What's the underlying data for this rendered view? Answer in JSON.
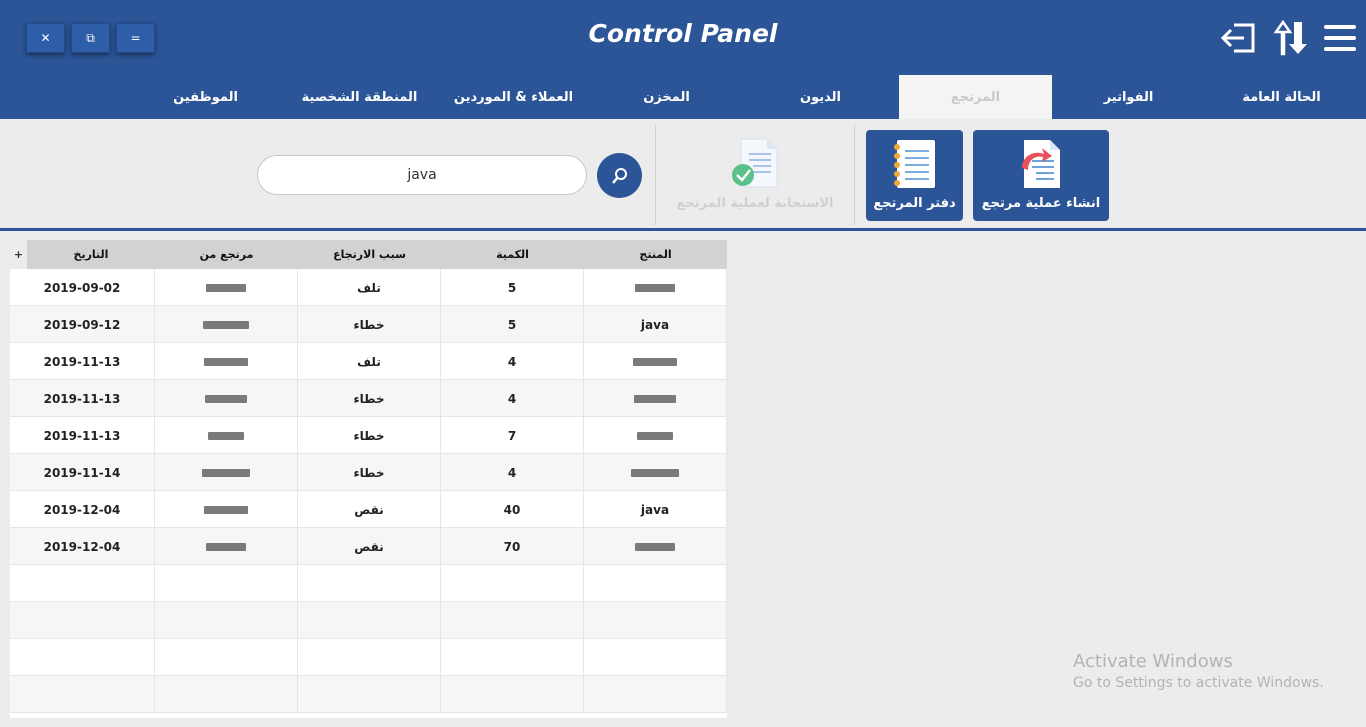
{
  "window": {
    "title": "Control Panel",
    "buttons": [
      {
        "id": "close",
        "glyph": "✕"
      },
      {
        "id": "restore",
        "glyph": "⧉"
      },
      {
        "id": "minimize",
        "glyph": "="
      }
    ]
  },
  "header_icons": [
    "logout-icon",
    "sort-icon",
    "menu-icon"
  ],
  "tabs": [
    {
      "label": "الحالة العامة",
      "active": false
    },
    {
      "label": "الفواتير",
      "active": false
    },
    {
      "label": "المرتجع",
      "active": true
    },
    {
      "label": "الديون",
      "active": false
    },
    {
      "label": "المخزن",
      "active": false
    },
    {
      "label": "العملاء  &  الموردين",
      "active": false
    },
    {
      "label": "المنطقة الشخصية",
      "active": false
    },
    {
      "label": "الموظفين",
      "active": false
    }
  ],
  "toolbar": {
    "create_return_label": "انشاء عملية مرتجع",
    "returns_ledger_label": "دفتر المرتجع",
    "respond_return_label": "الاستجابة لعملية المرتجع",
    "search_value": "java"
  },
  "table": {
    "corner_glyph": "+",
    "columns": [
      "المنتج",
      "الكمية",
      "سبب الارتجاع",
      "مرتجع من",
      "التاريخ"
    ],
    "rows": [
      {
        "product": "■■■■",
        "qty": "5",
        "reason": "تلف",
        "from": "■■■■",
        "date": "2019-09-02"
      },
      {
        "product": "java",
        "qty": "5",
        "reason": "خطاء",
        "from": "■■■■",
        "date": "2019-09-12"
      },
      {
        "product": "■■■■",
        "qty": "4",
        "reason": "تلف",
        "from": "■■■■",
        "date": "2019-11-13"
      },
      {
        "product": "■■■■",
        "qty": "4",
        "reason": "خطاء",
        "from": "■■■■",
        "date": "2019-11-13"
      },
      {
        "product": "■■■■",
        "qty": "7",
        "reason": "خطاء",
        "from": "■■■■",
        "date": "2019-11-13"
      },
      {
        "product": "■■■■",
        "qty": "4",
        "reason": "خطاء",
        "from": "■■■■",
        "date": "2019-11-14"
      },
      {
        "product": "java",
        "qty": "40",
        "reason": "نقص",
        "from": "■■■■",
        "date": "2019-12-04"
      },
      {
        "product": "■■■■",
        "qty": "70",
        "reason": "نقص",
        "from": "■■■■",
        "date": "2019-12-04"
      }
    ],
    "empty_rows": 4
  },
  "watermark": {
    "line1": "Activate Windows",
    "line2": "Go to Settings to activate Windows."
  },
  "colors": {
    "header": "#2b5597",
    "background": "#ececec",
    "table_header": "#d2d2d2"
  }
}
